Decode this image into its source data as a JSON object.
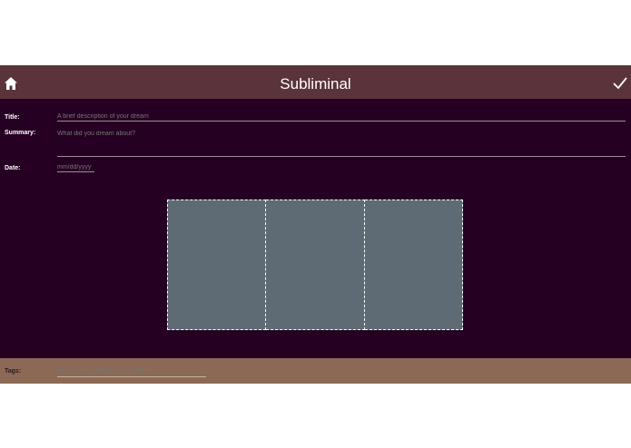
{
  "header": {
    "title": "Subliminal",
    "home_icon": "home-icon",
    "confirm_icon": "check-icon",
    "bg_color": "#5a333b"
  },
  "form": {
    "title_label": "Title:",
    "title_placeholder": "A brief description of your dream",
    "summary_label": "Summary:",
    "summary_placeholder": "What did you dream about?",
    "date_label": "Date:",
    "date_placeholder": "mm/dd/yyyy",
    "bg_color": "#260022"
  },
  "media": {
    "slots": 3,
    "slot_color": "#5e6b74"
  },
  "footer": {
    "tags_label": "Tags:",
    "tags_placeholder": "Keywords to describe your dream",
    "bg_color": "#8b6954"
  }
}
